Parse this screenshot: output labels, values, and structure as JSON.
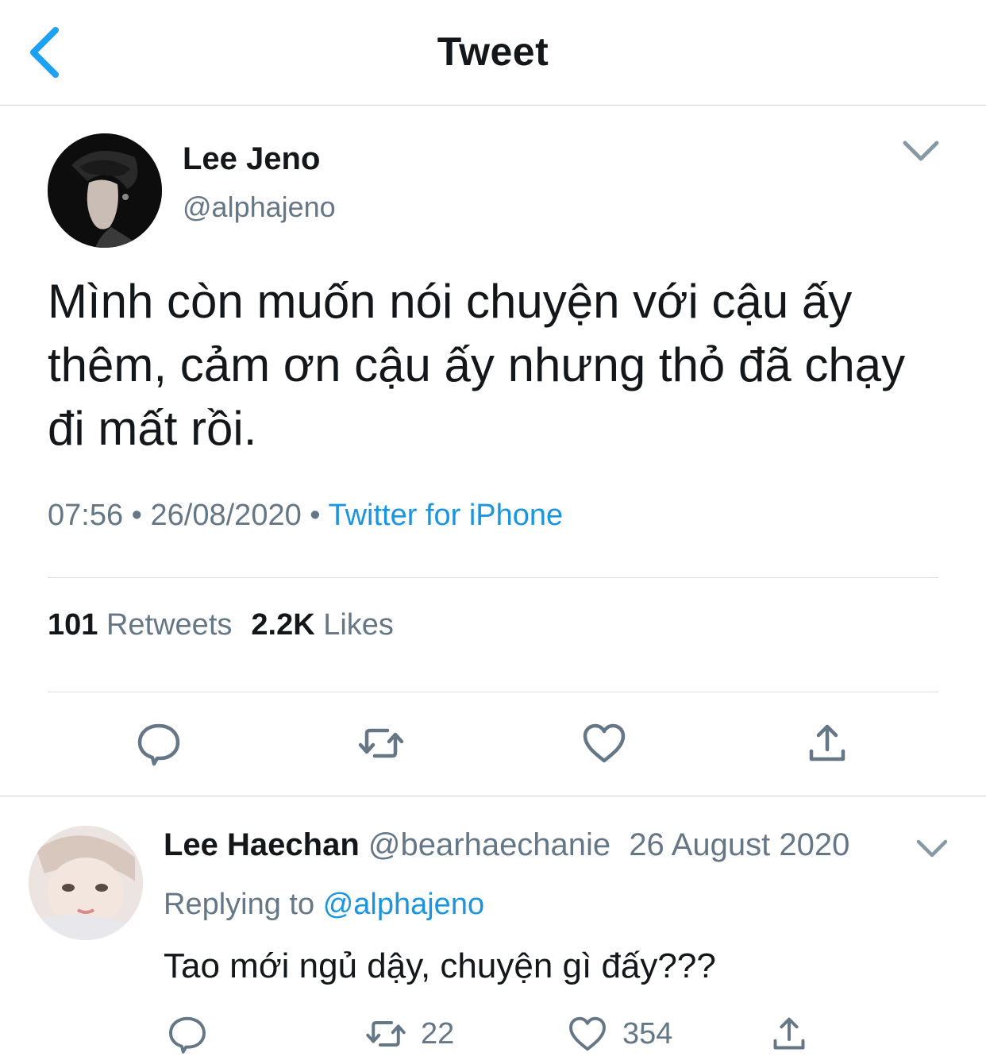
{
  "header": {
    "title": "Tweet",
    "back_icon": "chevron-left-icon"
  },
  "tweet": {
    "author_name": "Lee Jeno",
    "author_handle": "@alphajeno",
    "text": "Mình còn muốn nói chuyện với cậu ấy thêm, cảm ơn cậu ấy nhưng thỏ đã chạy đi mất rồi.",
    "time": "07:56",
    "date": "26/08/2020",
    "separator": "•",
    "source": "Twitter for iPhone",
    "retweet_count": "101",
    "retweet_label": "Retweets",
    "like_count": "2.2K",
    "like_label": "Likes"
  },
  "actions": [
    "reply-icon",
    "retweet-icon",
    "like-icon",
    "share-icon"
  ],
  "reply": {
    "author_name": "Lee Haechan",
    "author_handle": "@bearhaechanie",
    "date": "26 August 2020",
    "replying_prefix": "Replying to",
    "replying_to": "@alphajeno",
    "text": "Tao mới ngủ dậy, chuyện gì đấy???",
    "retweet_count": "22",
    "like_count": "354"
  },
  "colors": {
    "accent": "#1da1f2",
    "link": "#1b95e0",
    "muted": "#657786",
    "divider": "#d6dbe0"
  }
}
